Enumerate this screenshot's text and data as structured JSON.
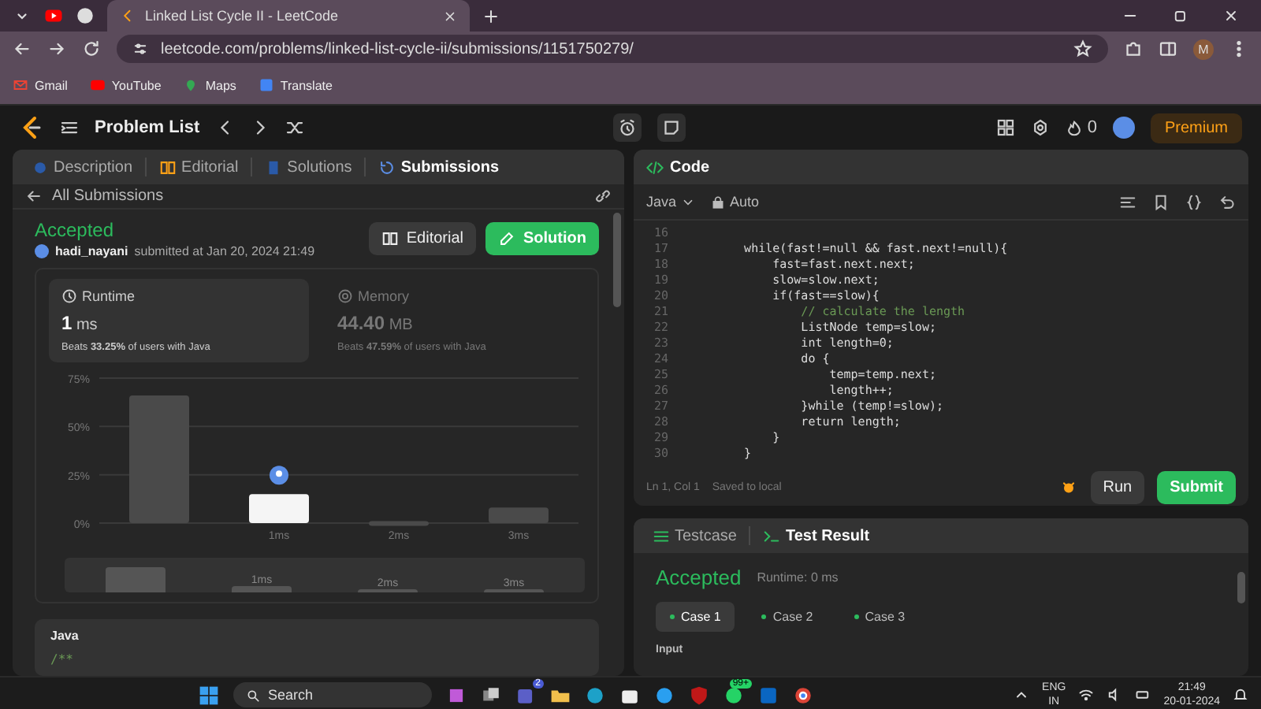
{
  "browser": {
    "tabs": [
      {
        "title": "Linked List Cycle II - LeetCode",
        "selected": true
      }
    ],
    "url": "leetcode.com/problems/linked-list-cycle-ii/submissions/1151750279/",
    "profile_initial": "M",
    "bookmarks": [
      "Gmail",
      "YouTube",
      "Maps",
      "Translate"
    ]
  },
  "nav": {
    "title": "Problem List",
    "streak": "0",
    "premium": "Premium"
  },
  "left_tabs": [
    {
      "label": "Description",
      "selected": false
    },
    {
      "label": "Editorial",
      "selected": false
    },
    {
      "label": "Solutions",
      "selected": false
    },
    {
      "label": "Submissions",
      "selected": true
    }
  ],
  "back_link": "All Submissions",
  "submission": {
    "status": "Accepted",
    "user": "hadi_nayani",
    "submitted": "submitted at Jan 20, 2024 21:49",
    "buttons": [
      {
        "label": "Editorial",
        "kind": "secondary"
      },
      {
        "label": "Solution",
        "kind": "primary"
      }
    ]
  },
  "stats": [
    {
      "title": "Runtime",
      "value": "1",
      "unit": "ms",
      "beats": "Beats **33.25%** of users with Java",
      "selected": true
    },
    {
      "title": "Memory",
      "value": "44.40",
      "unit": "MB",
      "beats": "Beats **47.59%** of users with Java",
      "selected": false
    }
  ],
  "chart_data": {
    "type": "bar",
    "categories": [
      null,
      "1ms",
      "2ms",
      "3ms"
    ],
    "values": [
      66,
      15,
      1,
      8
    ],
    "ylim": [
      0,
      75
    ],
    "yticks": [
      {
        "value": 0,
        "label": "0%"
      },
      {
        "value": 25,
        "label": "25%"
      },
      {
        "value": 50,
        "label": "50%"
      },
      {
        "value": 75,
        "label": "75%"
      }
    ]
  },
  "overview_labels": [
    "1ms",
    "2ms",
    "3ms"
  ],
  "code_section": {
    "language": "Java",
    "snippet": "/**"
  },
  "code_panel": {
    "title": "Code",
    "language": "Java",
    "mode": "Auto",
    "lines": [
      {
        "num": "16"
      },
      {
        "num": "17",
        "text": "    while(fast!=null && fast.next!=null){",
        "kind": "code"
      },
      {
        "num": "18",
        "text": "        fast=fast.next.next;",
        "kind": "code"
      },
      {
        "num": "19",
        "text": "        slow=slow.next;",
        "kind": "code"
      },
      {
        "num": "20",
        "text": "        if(fast==slow){",
        "kind": "code"
      },
      {
        "num": "21",
        "text": "            // calculate the length",
        "kind": "comment"
      },
      {
        "num": "22",
        "text": "            ListNode temp=slow;",
        "kind": "code"
      },
      {
        "num": "23",
        "text": "            int length=0;",
        "kind": "code"
      },
      {
        "num": "24",
        "text": "            do {",
        "kind": "code"
      },
      {
        "num": "25",
        "text": "                temp=temp.next;",
        "kind": "code"
      },
      {
        "num": "26",
        "text": "                length++;",
        "kind": "code"
      },
      {
        "num": "27",
        "text": "            }while (temp!=slow);",
        "kind": "code"
      },
      {
        "num": "28",
        "text": "            return length;",
        "kind": "code"
      },
      {
        "num": "29",
        "text": "        }",
        "kind": "code"
      },
      {
        "num": "30",
        "text": "    }",
        "kind": "code"
      }
    ],
    "cursor": "Ln 1, Col 1",
    "saved": "Saved to local",
    "run": "Run",
    "submit": "Submit"
  },
  "result_panel": {
    "tabs": [
      {
        "label": "Testcase",
        "selected": false
      },
      {
        "label": "Test Result",
        "selected": true
      }
    ],
    "status": "Accepted",
    "runtime": "Runtime: 0 ms",
    "cases": [
      {
        "label": "Case 1",
        "selected": true
      },
      {
        "label": "Case 2",
        "selected": false
      },
      {
        "label": "Case 3",
        "selected": false
      }
    ],
    "input_label": "Input"
  },
  "taskbar": {
    "search": "Search",
    "teams_badge": "2",
    "chat_badge": "99+",
    "lang": "ENG",
    "region": "IN",
    "time": "21:49",
    "date": "20-01-2024"
  }
}
